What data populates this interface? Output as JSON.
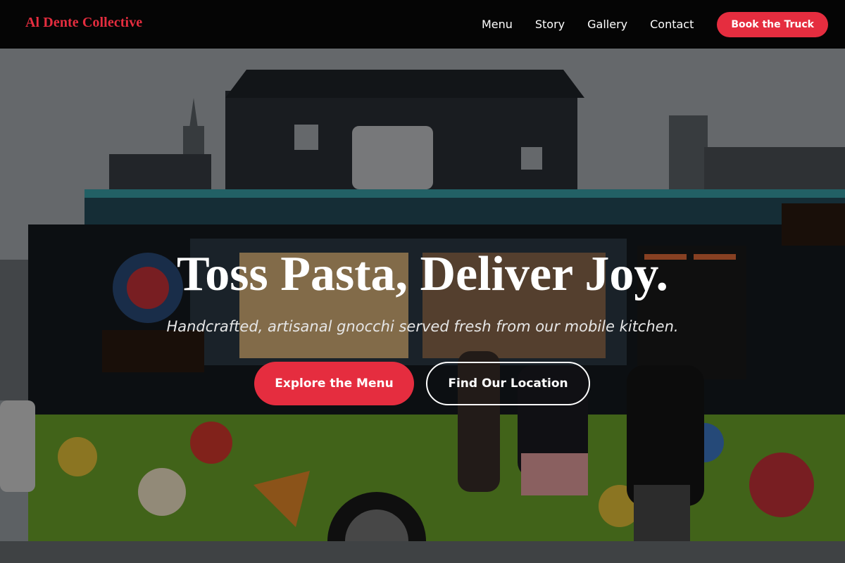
{
  "nav": {
    "logo": "Al Dente Collective",
    "links": [
      "Menu",
      "Story",
      "Gallery",
      "Contact"
    ],
    "cta": "Book the Truck"
  },
  "hero": {
    "title": "Toss Pasta, Deliver Joy.",
    "subtitle": "Handcrafted, artisanal gnocchi served fresh from our mobile kitchen.",
    "primary_button": "Explore the Menu",
    "secondary_button": "Find Our Location",
    "photo_subject": "colorful food truck with customers ordering at the window"
  },
  "colors": {
    "accent": "#e52d3f",
    "nav_background": "#050505",
    "text": "#ffffff"
  }
}
